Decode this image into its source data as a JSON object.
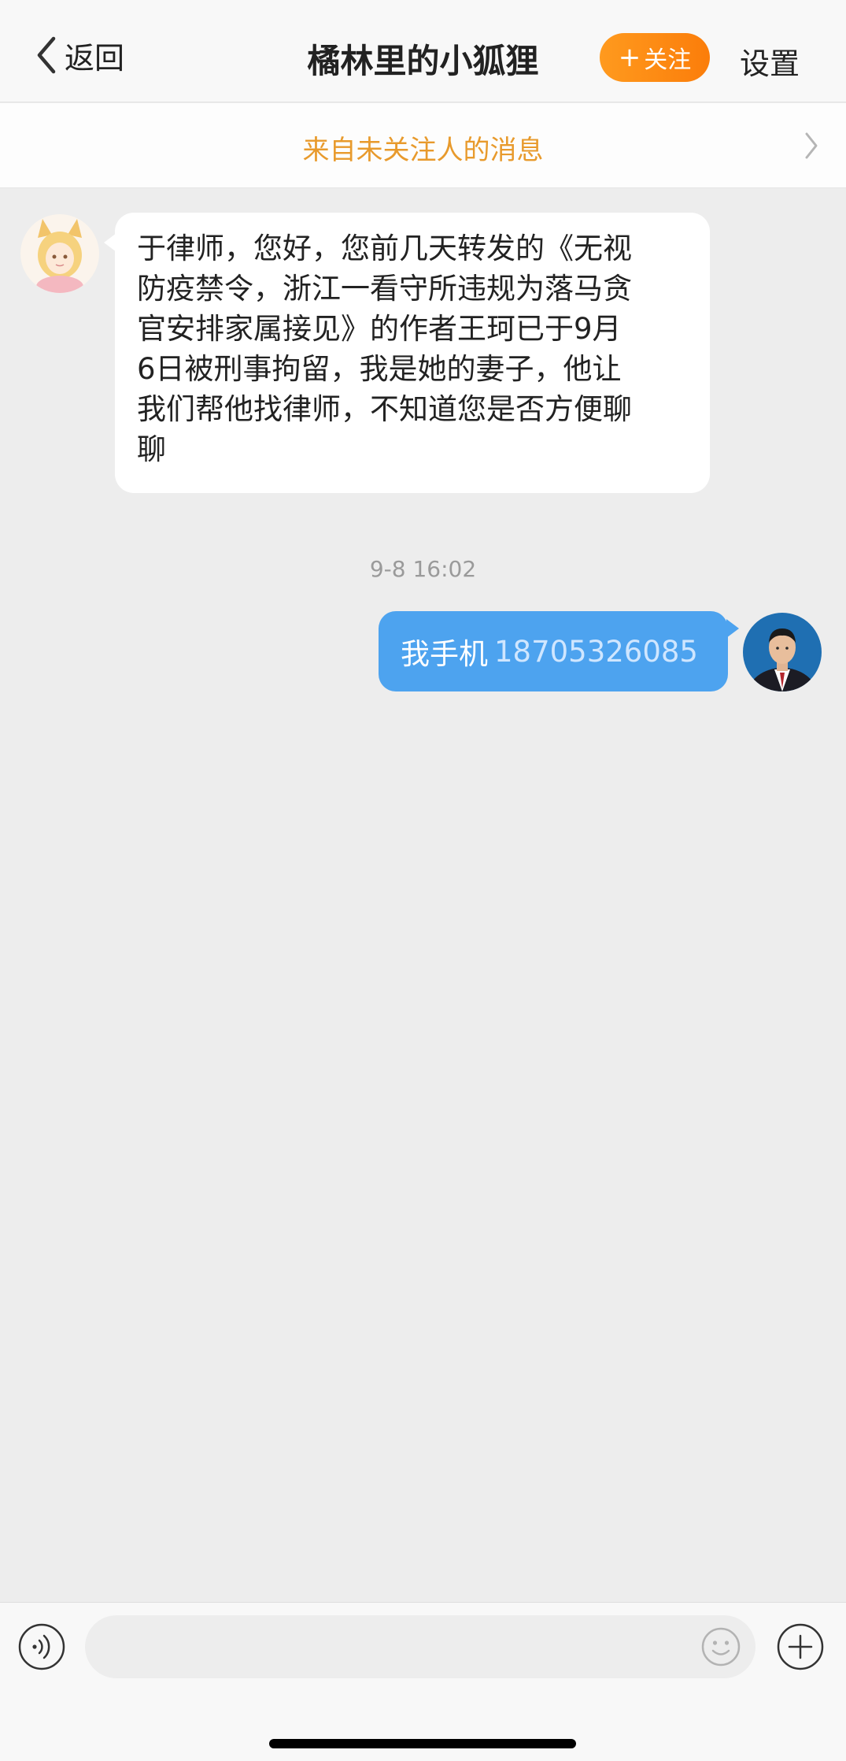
{
  "nav": {
    "back_label": "返回",
    "title": "橘林里的小狐狸",
    "follow_button": {
      "plus": "+",
      "label": "关注"
    },
    "settings_label": "设置"
  },
  "banner": {
    "text": "来自未关注人的消息"
  },
  "messages": [
    {
      "direction": "incoming",
      "lines": [
        "于律师，您好，您前几天转发的《无视",
        "防疫禁令，浙江一看守所违规为落马贪",
        "官安排家属接见》的作者王珂已于9月",
        "6日被刑事拘留，我是她的妻子，他让",
        "我们帮他找律师，不知道您是否方便聊",
        "聊"
      ]
    },
    {
      "direction": "outgoing",
      "timestamp": "9-8 16:02",
      "prefix": "我手机",
      "phone": "18705326085"
    }
  ],
  "input_bar": {
    "placeholder": "",
    "icons": [
      "voice-icon",
      "emoji-icon",
      "plus-icon"
    ]
  },
  "colors": {
    "accent_orange": "#fb8a12",
    "banner_text": "#e89a2c",
    "outgoing_bubble": "#4da3ef",
    "background": "#ededed"
  }
}
